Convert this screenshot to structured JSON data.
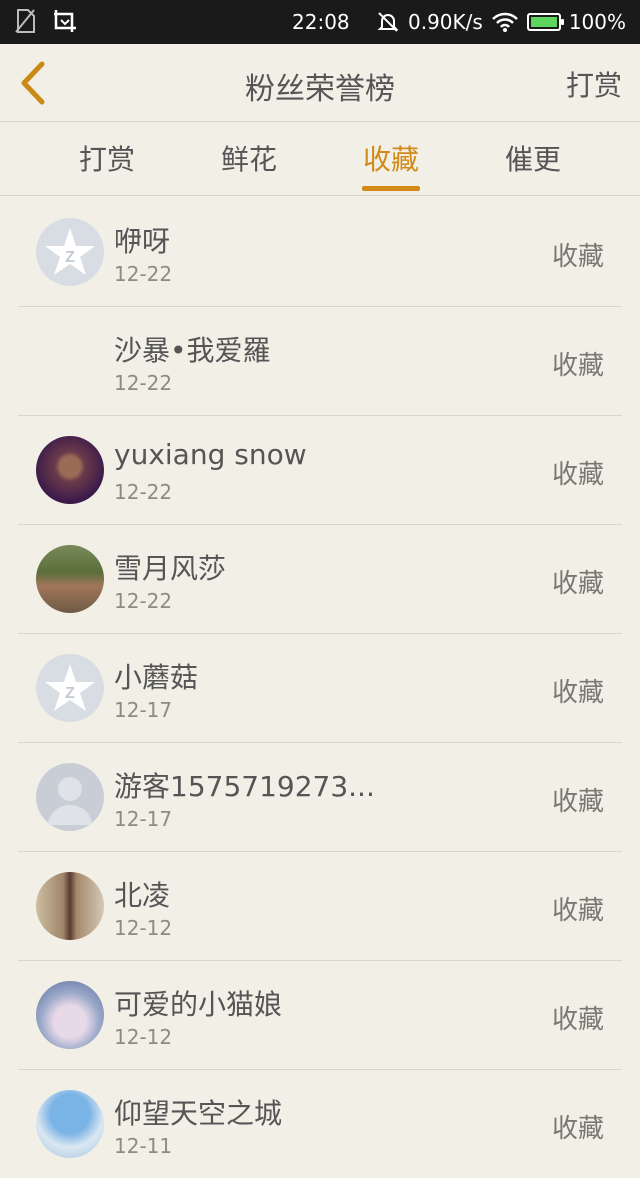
{
  "status_bar": {
    "time": "22:08",
    "net_speed": "0.90K/s",
    "battery": "100%",
    "icons": [
      "no-sim-icon",
      "screenshot-icon",
      "mute-bell-icon",
      "wifi-icon",
      "battery-icon"
    ]
  },
  "header": {
    "title": "粉丝荣誉榜",
    "right_action": "打赏",
    "back_icon": "chevron-left-icon"
  },
  "tabs": [
    {
      "label": "打赏"
    },
    {
      "label": "鲜花"
    },
    {
      "label": "收藏"
    },
    {
      "label": "催更"
    }
  ],
  "active_tab": "收藏",
  "colors": {
    "accent": "#d28a18",
    "text": "#555555",
    "background": "#f1efe6"
  },
  "list": [
    {
      "name": "咿呀",
      "date": "12-22",
      "action": "收藏",
      "avatar": "qq-star-avatar"
    },
    {
      "name": "沙暴•我爱羅",
      "date": "12-22",
      "action": "收藏",
      "avatar": "none"
    },
    {
      "name": "yuxiang snow",
      "date": "12-22",
      "action": "收藏",
      "avatar": "photo-avatar"
    },
    {
      "name": "雪月风莎",
      "date": "12-22",
      "action": "收藏",
      "avatar": "photo-avatar"
    },
    {
      "name": "小蘑菇",
      "date": "12-17",
      "action": "收藏",
      "avatar": "qq-star-avatar"
    },
    {
      "name": "游客1575719273...",
      "date": "12-17",
      "action": "收藏",
      "avatar": "default-person-avatar"
    },
    {
      "name": "北凌",
      "date": "12-12",
      "action": "收藏",
      "avatar": "photo-avatar"
    },
    {
      "name": "可爱的小猫娘",
      "date": "12-12",
      "action": "收藏",
      "avatar": "anime-avatar"
    },
    {
      "name": "仰望天空之城",
      "date": "12-11",
      "action": "收藏",
      "avatar": "anime-avatar"
    }
  ]
}
